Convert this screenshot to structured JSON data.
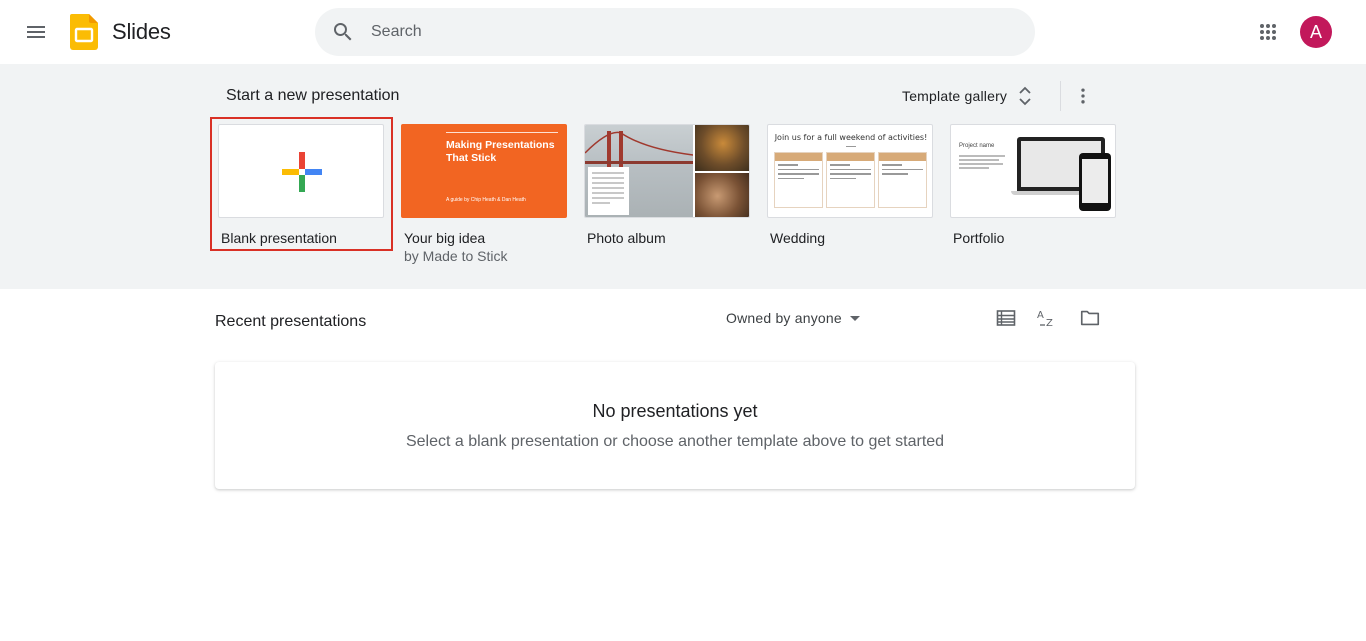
{
  "header": {
    "app_name": "Slides",
    "search_placeholder": "Search",
    "avatar_initial": "A",
    "avatar_color": "#c2185b"
  },
  "templates": {
    "section_title": "Start a new presentation",
    "gallery_label": "Template gallery",
    "items": [
      {
        "name": "Blank presentation",
        "subtitle": "",
        "selected": true
      },
      {
        "name": "Your big idea",
        "subtitle": "by Made to Stick",
        "thumb_title": "Making Presentations That Stick",
        "thumb_sub": "A guide by Chip Heath & Dan Heath"
      },
      {
        "name": "Photo album",
        "subtitle": ""
      },
      {
        "name": "Wedding",
        "subtitle": "",
        "thumb_title": "Join us for a full weekend of activities!",
        "columns": [
          "Thursday",
          "Saturday",
          "Sunday"
        ]
      },
      {
        "name": "Portfolio",
        "subtitle": "",
        "thumb_title": "Project name"
      }
    ]
  },
  "recent": {
    "title": "Recent presentations",
    "owner_filter": "Owned by anyone",
    "empty_title": "No presentations yet",
    "empty_subtitle": "Select a blank presentation or choose another template above to get started"
  },
  "colors": {
    "band_bg": "#f1f3f4",
    "selection_outline": "#d93025",
    "orange_theme": "#f26522"
  }
}
